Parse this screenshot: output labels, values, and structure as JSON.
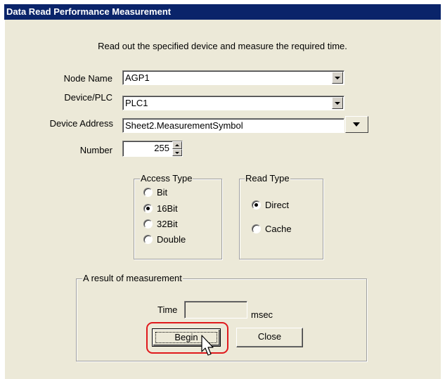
{
  "window": {
    "title": "Data Read Performance Measurement"
  },
  "description": "Read out the specified device and measure the required time.",
  "form": {
    "node_name": {
      "label": "Node Name",
      "value": "AGP1"
    },
    "device_plc": {
      "label": "Device/PLC",
      "value": "PLC1"
    },
    "device_address": {
      "label": "Device Address",
      "value": "Sheet2.MeasurementSymbol"
    },
    "number": {
      "label": "Number",
      "value": "255"
    }
  },
  "access_type": {
    "title": "Access Type",
    "options": [
      "Bit",
      "16Bit",
      "32Bit",
      "Double"
    ],
    "selected": "16Bit"
  },
  "read_type": {
    "title": "Read Type",
    "options": [
      "Direct",
      "Cache"
    ],
    "selected": "Direct"
  },
  "result": {
    "title": "A result of measurement",
    "time_label": "Time",
    "time_value": "",
    "unit": "msec"
  },
  "buttons": {
    "begin": "Begin",
    "close": "Close"
  },
  "colors": {
    "titlebar": "#0a246a",
    "dialog": "#ece9d8",
    "highlight": "#e0191c"
  }
}
